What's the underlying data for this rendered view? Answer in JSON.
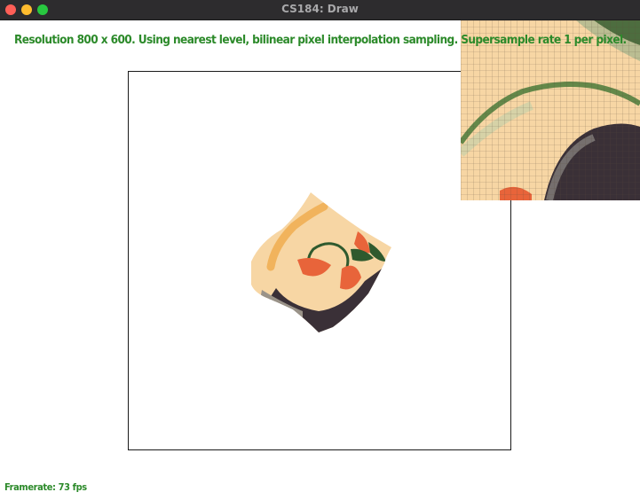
{
  "window": {
    "title": "CS184: Draw",
    "controls": [
      "close",
      "minimize",
      "maximize"
    ]
  },
  "overlay": {
    "status_text": "Resolution 800 x 600. Using nearest level, bilinear pixel interpolation sampling. Supersample rate 1 per pixel.",
    "framerate_text": "Framerate: 73 fps"
  },
  "colors": {
    "overlay_text": "#2c8a2a",
    "texture_cream": "#f7d6a4",
    "texture_orange": "#e8643a",
    "texture_green": "#2f5a2e",
    "texture_dark": "#3a3037",
    "texture_gray": "#9a9389"
  }
}
